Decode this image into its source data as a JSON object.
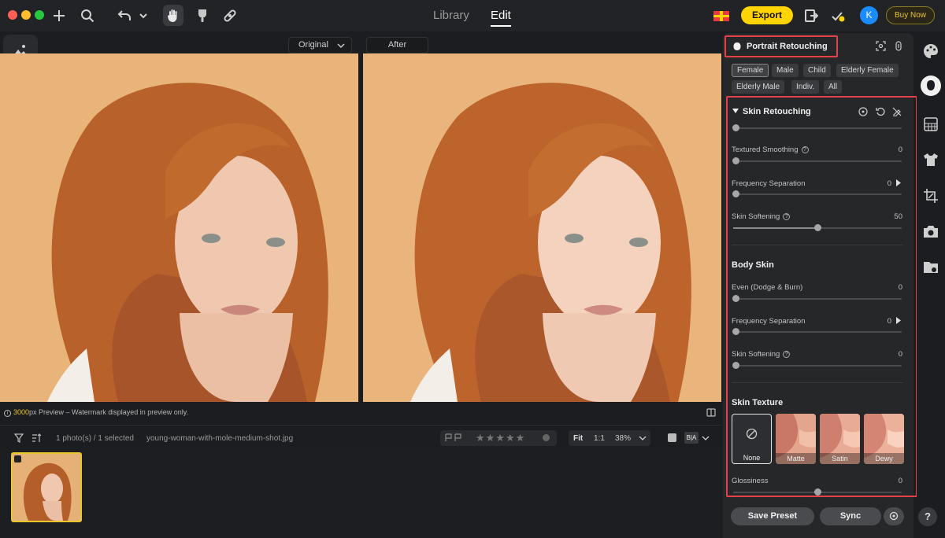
{
  "topbar": {
    "tabs": [
      {
        "label": "Library",
        "active": false
      },
      {
        "label": "Edit",
        "active": true
      }
    ],
    "export_label": "Export",
    "avatar_initial": "K",
    "buy_label": "Buy Now",
    "accent_color": "#ffd400"
  },
  "compare": {
    "left_select": "Original",
    "right_label": "After"
  },
  "preview_note": {
    "size": "3000",
    "rest": "px Preview – Watermark displayed in preview only."
  },
  "filmstrip": {
    "selection": "1 photo(s) / 1 selected",
    "filename": "young-woman-with-mole-medium-shot.jpg",
    "fit_label": "Fit",
    "ratio_label": "1:1",
    "zoom": "38%",
    "compare_label": "B|A"
  },
  "panel": {
    "title": "Portrait Retouching",
    "filters": [
      {
        "label": "Female",
        "selected": true
      },
      {
        "label": "Male",
        "selected": false
      },
      {
        "label": "Child",
        "selected": false
      },
      {
        "label": "Elderly Female",
        "selected": false
      },
      {
        "label": "Elderly Male",
        "selected": false
      },
      {
        "label": "Indiv.",
        "selected": false
      },
      {
        "label": "All",
        "selected": false
      }
    ],
    "skin_retouching": {
      "title": "Skin Retouching",
      "sliders": [
        {
          "label": "Textured Smoothing",
          "value": "0",
          "level": 0
        },
        {
          "label": "Frequency Separation",
          "value": "0",
          "level": 0
        },
        {
          "label": "Skin Softening",
          "value": "50",
          "level": 0.5
        }
      ]
    },
    "body_skin": {
      "title": "Body Skin",
      "sliders": [
        {
          "label": "Even (Dodge & Burn)",
          "value": "0",
          "level": 0
        },
        {
          "label": "Frequency Separation",
          "value": "0",
          "level": 0
        },
        {
          "label": "Skin Softening",
          "value": "0",
          "level": 0
        }
      ]
    },
    "skin_texture": {
      "title": "Skin Texture",
      "options": [
        {
          "label": "None",
          "selected": true
        },
        {
          "label": "Matte",
          "selected": false
        },
        {
          "label": "Satin",
          "selected": false
        },
        {
          "label": "Dewy",
          "selected": false
        }
      ],
      "glossiness_label": "Glossiness",
      "glossiness_value": "0",
      "glossiness_level": 0.5
    },
    "save_preset_label": "Save Preset",
    "sync_label": "Sync"
  },
  "help_label": "?",
  "highlight_color": "#e5414c"
}
